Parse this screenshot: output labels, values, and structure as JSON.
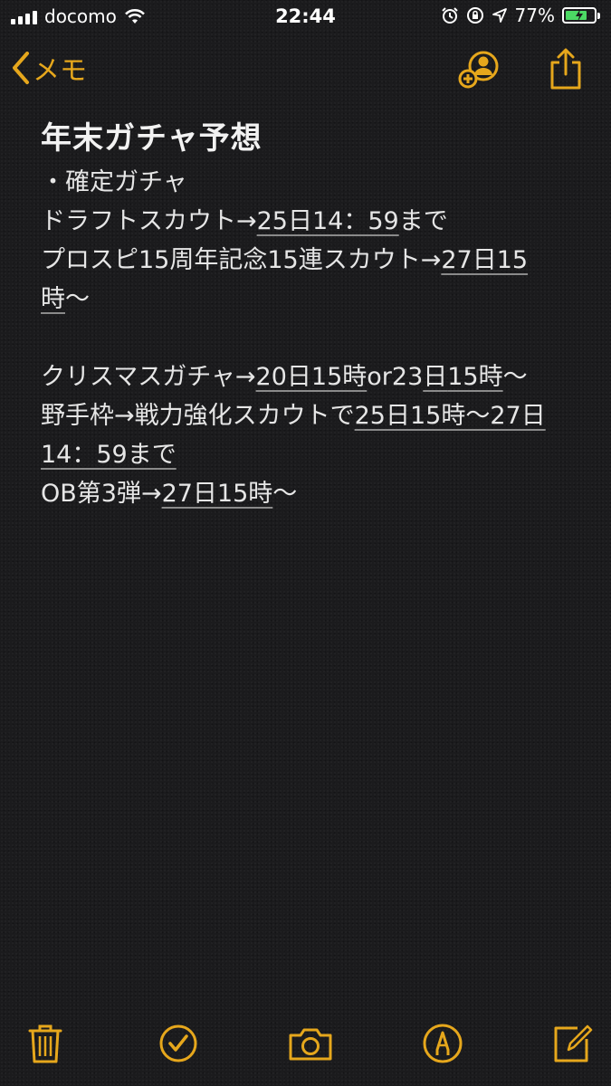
{
  "status": {
    "carrier": "docomo",
    "time": "22:44",
    "battery_percent_label": "77%",
    "battery_level": 0.77,
    "battery_color": "#4cd964"
  },
  "nav": {
    "back_label": "メモ",
    "accent_color": "#e6a71c",
    "icons": [
      "add-people-icon",
      "share-icon"
    ]
  },
  "note": {
    "title": "年末ガチャ予想",
    "lines": {
      "l1": "・確定ガチャ",
      "l2a": "ドラフトスカウト→",
      "l2b": "25日14：59",
      "l2c": "まで",
      "l3a": "プロスピ15周年記念15連スカウト→",
      "l3b": "27日15",
      "l4a": "時",
      "l4b": "〜",
      "l6a": "クリスマスガチャ→",
      "l6b": "20日15時",
      "l6c": "or23",
      "l6d": "日",
      "l6e": "15時",
      "l6f": "〜",
      "l7a": "野手枠→戦力強化スカウトで",
      "l7b": "25日15時〜27日",
      "l8a": "14：59まで",
      "l9a": "OB第3弾→",
      "l9b": "27日15時",
      "l9c": "〜"
    }
  },
  "toolbar": {
    "icons": [
      "trash-icon",
      "checklist-icon",
      "camera-icon",
      "markup-icon",
      "compose-icon"
    ]
  }
}
